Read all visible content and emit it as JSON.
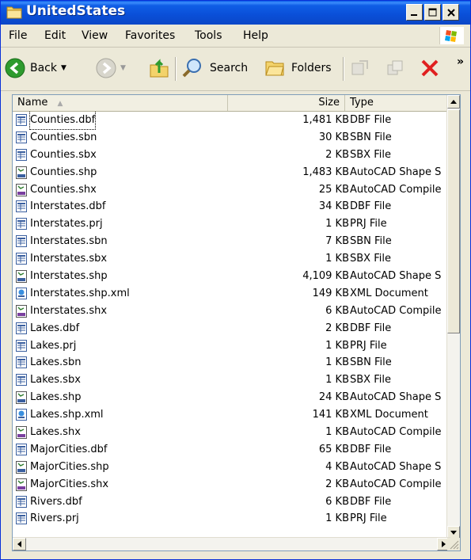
{
  "window": {
    "title": "UnitedStates"
  },
  "menu": [
    "File",
    "Edit",
    "View",
    "Favorites",
    "Tools",
    "Help"
  ],
  "toolbar": {
    "back": "Back",
    "search": "Search",
    "folders": "Folders",
    "more": "»"
  },
  "columns": {
    "name": "Name",
    "size": "Size",
    "type": "Type"
  },
  "files": [
    {
      "name": "Counties.dbf",
      "size": "1,481 KB",
      "type": "DBF File",
      "icon": "table-file-icon"
    },
    {
      "name": "Counties.sbn",
      "size": "30 KB",
      "type": "SBN File",
      "icon": "table-file-icon"
    },
    {
      "name": "Counties.sbx",
      "size": "2 KB",
      "type": "SBX File",
      "icon": "table-file-icon"
    },
    {
      "name": "Counties.shp",
      "size": "1,483 KB",
      "type": "AutoCAD Shape S",
      "icon": "shp-file-icon"
    },
    {
      "name": "Counties.shx",
      "size": "25 KB",
      "type": "AutoCAD Compile",
      "icon": "shx-file-icon"
    },
    {
      "name": "Interstates.dbf",
      "size": "34 KB",
      "type": "DBF File",
      "icon": "table-file-icon"
    },
    {
      "name": "Interstates.prj",
      "size": "1 KB",
      "type": "PRJ File",
      "icon": "table-file-icon"
    },
    {
      "name": "Interstates.sbn",
      "size": "7 KB",
      "type": "SBN File",
      "icon": "table-file-icon"
    },
    {
      "name": "Interstates.sbx",
      "size": "1 KB",
      "type": "SBX File",
      "icon": "table-file-icon"
    },
    {
      "name": "Interstates.shp",
      "size": "4,109 KB",
      "type": "AutoCAD Shape S",
      "icon": "shp-file-icon"
    },
    {
      "name": "Interstates.shp.xml",
      "size": "149 KB",
      "type": "XML Document",
      "icon": "xml-file-icon"
    },
    {
      "name": "Interstates.shx",
      "size": "6 KB",
      "type": "AutoCAD Compile",
      "icon": "shx-file-icon"
    },
    {
      "name": "Lakes.dbf",
      "size": "2 KB",
      "type": "DBF File",
      "icon": "table-file-icon"
    },
    {
      "name": "Lakes.prj",
      "size": "1 KB",
      "type": "PRJ File",
      "icon": "table-file-icon"
    },
    {
      "name": "Lakes.sbn",
      "size": "1 KB",
      "type": "SBN File",
      "icon": "table-file-icon"
    },
    {
      "name": "Lakes.sbx",
      "size": "1 KB",
      "type": "SBX File",
      "icon": "table-file-icon"
    },
    {
      "name": "Lakes.shp",
      "size": "24 KB",
      "type": "AutoCAD Shape S",
      "icon": "shp-file-icon"
    },
    {
      "name": "Lakes.shp.xml",
      "size": "141 KB",
      "type": "XML Document",
      "icon": "xml-file-icon"
    },
    {
      "name": "Lakes.shx",
      "size": "1 KB",
      "type": "AutoCAD Compile",
      "icon": "shx-file-icon"
    },
    {
      "name": "MajorCities.dbf",
      "size": "65 KB",
      "type": "DBF File",
      "icon": "table-file-icon"
    },
    {
      "name": "MajorCities.shp",
      "size": "4 KB",
      "type": "AutoCAD Shape S",
      "icon": "shp-file-icon"
    },
    {
      "name": "MajorCities.shx",
      "size": "2 KB",
      "type": "AutoCAD Compile",
      "icon": "shx-file-icon"
    },
    {
      "name": "Rivers.dbf",
      "size": "6 KB",
      "type": "DBF File",
      "icon": "table-file-icon"
    },
    {
      "name": "Rivers.prj",
      "size": "1 KB",
      "type": "PRJ File",
      "icon": "table-file-icon"
    }
  ],
  "colors": {
    "titlebar": "#0a4fd8",
    "delete": "#e02020",
    "list_border": "#7f9db9"
  }
}
